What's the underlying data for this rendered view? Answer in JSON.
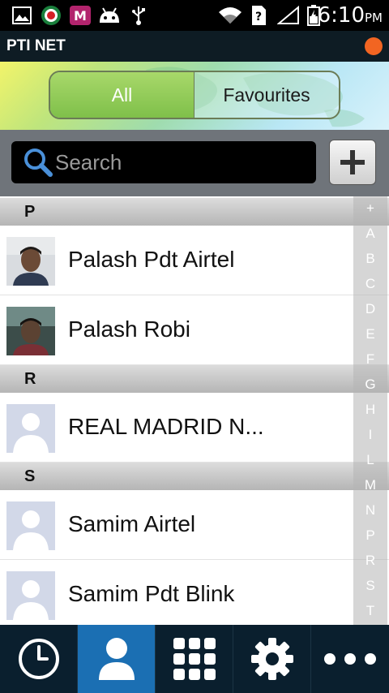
{
  "status_bar": {
    "time": "6:10",
    "ampm": "PM",
    "icons": [
      "gallery-icon",
      "pti-app-icon",
      "gmail-icon",
      "android-debug-icon",
      "usb-icon",
      "wifi-icon",
      "unknown-sim-icon",
      "signal-icon",
      "battery-icon"
    ],
    "brand_icon_letter": "M"
  },
  "app_bar": {
    "title": "PTI NET",
    "accent_color": "#f26522"
  },
  "tabs": [
    {
      "label": "All",
      "selected": true
    },
    {
      "label": "Favourites",
      "selected": false
    }
  ],
  "search": {
    "placeholder": "Search",
    "add_icon": "plus-icon"
  },
  "contacts": [
    {
      "section": "P",
      "items": [
        {
          "name": "Palash Pdt Airtel",
          "avatar": "photo"
        },
        {
          "name": "Palash Robi",
          "avatar": "photo"
        }
      ]
    },
    {
      "section": "R",
      "items": [
        {
          "name": "REAL MADRID N...",
          "avatar": "default"
        }
      ]
    },
    {
      "section": "S",
      "items": [
        {
          "name": "Samim Airtel",
          "avatar": "default"
        },
        {
          "name": "Samim Pdt Blink",
          "avatar": "default"
        }
      ]
    }
  ],
  "index_letters": [
    "+",
    "A",
    "B",
    "C",
    "D",
    "E",
    "F",
    "G",
    "H",
    "I",
    "L",
    "M",
    "N",
    "P",
    "R",
    "S",
    "T"
  ],
  "bottom_nav": [
    {
      "name": "history",
      "icon": "clock-icon",
      "active": false
    },
    {
      "name": "contacts",
      "icon": "person-icon",
      "active": true
    },
    {
      "name": "dialpad",
      "icon": "dialpad-icon",
      "active": false
    },
    {
      "name": "settings",
      "icon": "gear-icon",
      "active": false
    },
    {
      "name": "more",
      "icon": "more-dots-icon",
      "active": false
    }
  ],
  "colors": {
    "nav_background": "#0a1f2e",
    "nav_active": "#1b6fb3",
    "tab_selected": "#8ccb56"
  }
}
